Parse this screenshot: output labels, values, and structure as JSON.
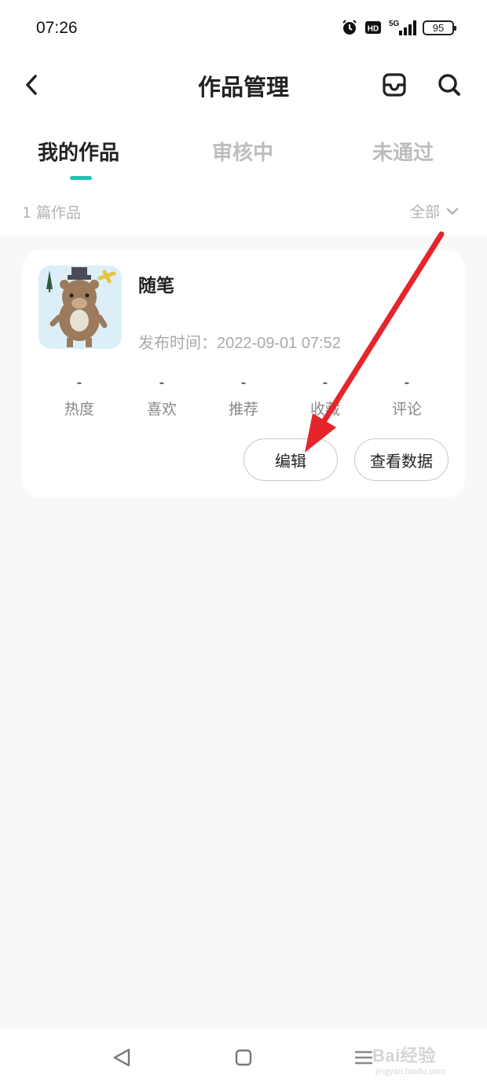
{
  "status_bar": {
    "time": "07:26",
    "network": "5G",
    "hd": "HD",
    "battery": "95",
    "icons": [
      "alarm-icon",
      "hd-icon",
      "signal-icon",
      "battery-icon"
    ]
  },
  "header": {
    "title": "作品管理",
    "icons": [
      "back-icon",
      "inbox-icon",
      "search-icon"
    ]
  },
  "tabs": [
    {
      "label": "我的作品",
      "active": true
    },
    {
      "label": "审核中",
      "active": false
    },
    {
      "label": "未通过",
      "active": false
    }
  ],
  "filter": {
    "count_text": "1 篇作品",
    "selected": "全部"
  },
  "work": {
    "title": "随笔",
    "publish_label": "发布时间：",
    "publish_time": "2022-09-01 07:52",
    "stats": [
      {
        "label": "热度",
        "value": "-"
      },
      {
        "label": "喜欢",
        "value": "-"
      },
      {
        "label": "推荐",
        "value": "-"
      },
      {
        "label": "收藏",
        "value": "-"
      },
      {
        "label": "评论",
        "value": "-"
      }
    ],
    "actions": {
      "edit": "编辑",
      "view_data": "查看数据"
    }
  },
  "watermark": {
    "text": "Bai经验",
    "sub": "jingyan.baidu.com"
  },
  "colors": {
    "accent": "#1fc2b4",
    "annotation_arrow": "#e5252a",
    "background": "#f8f8f8"
  }
}
